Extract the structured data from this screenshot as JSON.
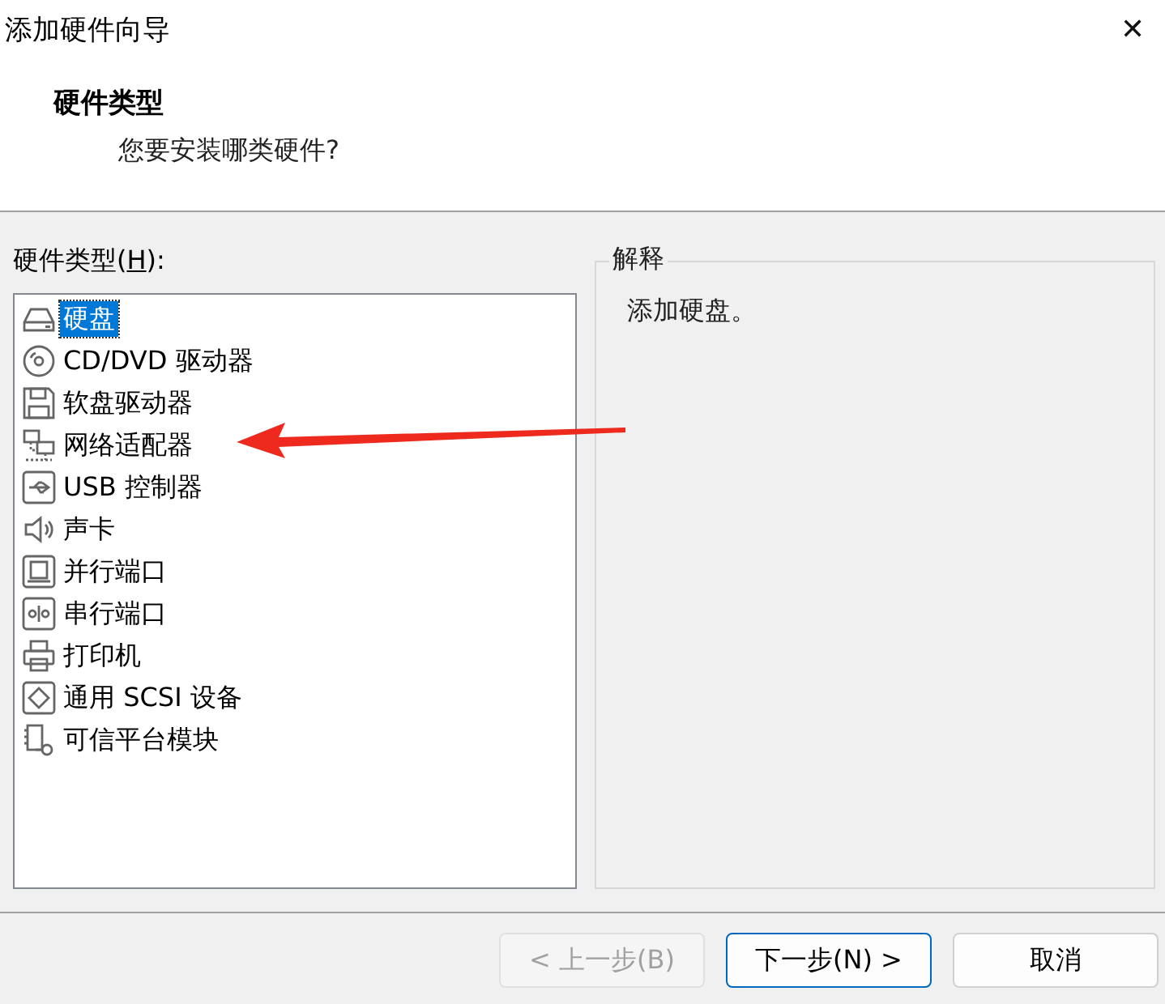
{
  "window": {
    "title": "添加硬件向导",
    "close": "✕"
  },
  "header": {
    "title": "硬件类型",
    "subtitle": "您要安装哪类硬件?"
  },
  "hardware_list": {
    "label_before": "硬件类型(",
    "label_key": "H",
    "label_after": "):",
    "items": [
      {
        "label": "硬盘",
        "selected": true
      },
      {
        "label": "CD/DVD 驱动器",
        "selected": false
      },
      {
        "label": "软盘驱动器",
        "selected": false
      },
      {
        "label": "网络适配器",
        "selected": false
      },
      {
        "label": "USB 控制器",
        "selected": false
      },
      {
        "label": "声卡",
        "selected": false
      },
      {
        "label": "并行端口",
        "selected": false
      },
      {
        "label": "串行端口",
        "selected": false
      },
      {
        "label": "打印机",
        "selected": false
      },
      {
        "label": "通用 SCSI 设备",
        "selected": false
      },
      {
        "label": "可信平台模块",
        "selected": false
      }
    ]
  },
  "explanation": {
    "title": "解释",
    "text": "添加硬盘。"
  },
  "annotation_arrow": {
    "color": "#ee2a1f"
  },
  "buttons": [
    {
      "label": "< 上一步(B)",
      "disabled": true,
      "default": false
    },
    {
      "label": "下一步(N) >",
      "disabled": false,
      "default": true
    },
    {
      "label": "取消",
      "disabled": false,
      "default": false
    }
  ]
}
